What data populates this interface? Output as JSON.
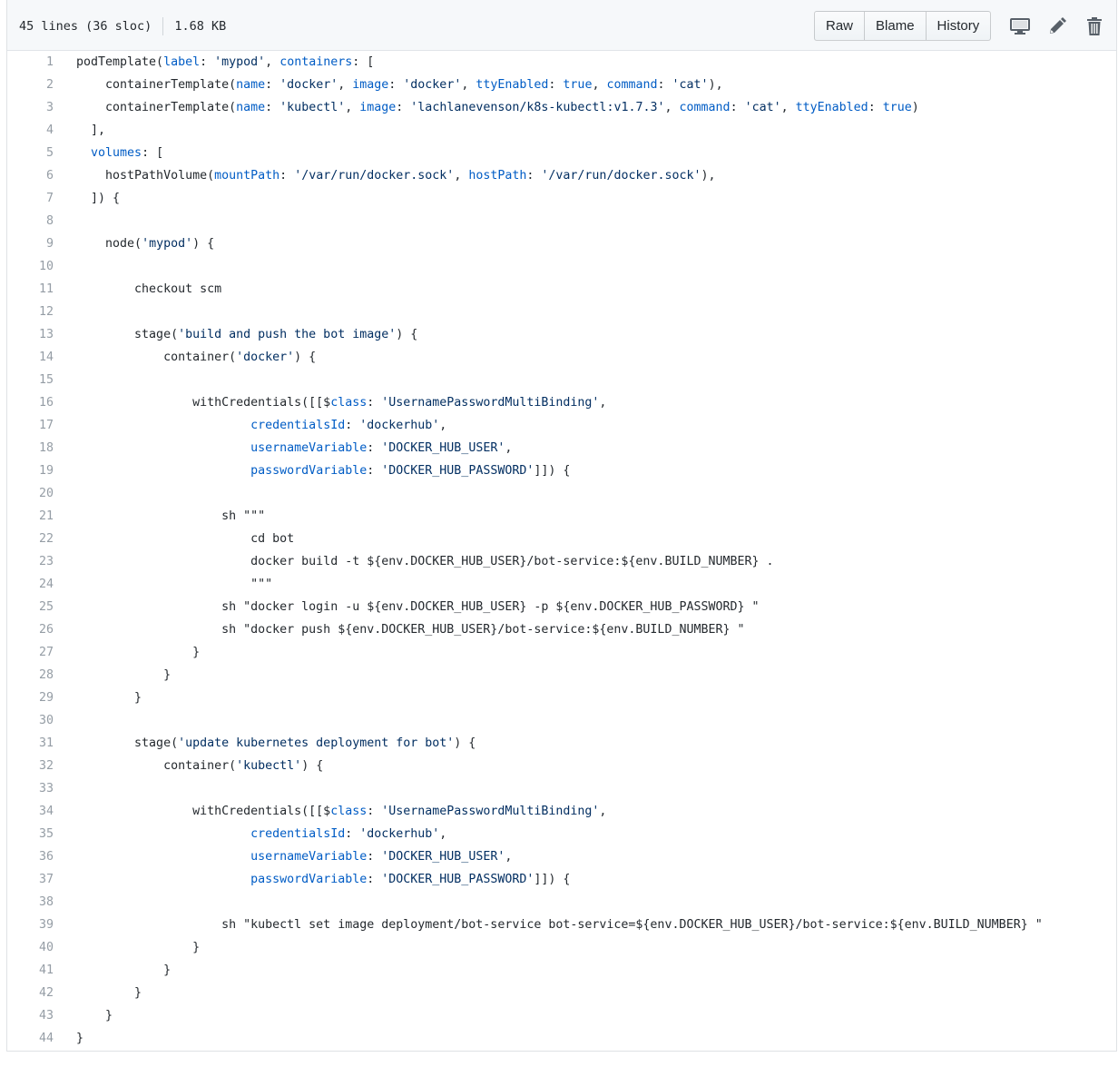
{
  "file": {
    "lines_info": "45 lines (36 sloc)",
    "size": "1.68 KB"
  },
  "toolbar": {
    "raw_label": "Raw",
    "blame_label": "Blame",
    "history_label": "History",
    "icons": {
      "desktop": "desktop-icon",
      "edit": "pencil-icon",
      "delete": "trash-icon"
    }
  },
  "colors": {
    "keyword": "#005cc5",
    "string": "#032f62",
    "line_number": "#959da5",
    "text": "#24292e"
  },
  "code_lines": [
    "podTemplate(label: 'mypod', containers: [",
    "    containerTemplate(name: 'docker', image: 'docker', ttyEnabled: true, command: 'cat'),",
    "    containerTemplate(name: 'kubectl', image: 'lachlanevenson/k8s-kubectl:v1.7.3', command: 'cat', ttyEnabled: true)",
    "  ],",
    "  volumes: [",
    "    hostPathVolume(mountPath: '/var/run/docker.sock', hostPath: '/var/run/docker.sock'),",
    "  ]) {",
    "",
    "    node('mypod') {",
    "",
    "        checkout scm",
    "",
    "        stage('build and push the bot image') {",
    "            container('docker') {",
    "",
    "                withCredentials([[$class: 'UsernamePasswordMultiBinding',",
    "                        credentialsId: 'dockerhub',",
    "                        usernameVariable: 'DOCKER_HUB_USER',",
    "                        passwordVariable: 'DOCKER_HUB_PASSWORD']]) {",
    "",
    "                    sh \"\"\"",
    "                        cd bot",
    "                        docker build -t ${env.DOCKER_HUB_USER}/bot-service:${env.BUILD_NUMBER} .",
    "                        \"\"\"",
    "                    sh \"docker login -u ${env.DOCKER_HUB_USER} -p ${env.DOCKER_HUB_PASSWORD} \"",
    "                    sh \"docker push ${env.DOCKER_HUB_USER}/bot-service:${env.BUILD_NUMBER} \"",
    "                }",
    "            }",
    "        }",
    "",
    "        stage('update kubernetes deployment for bot') {",
    "            container('kubectl') {",
    "",
    "                withCredentials([[$class: 'UsernamePasswordMultiBinding',",
    "                        credentialsId: 'dockerhub',",
    "                        usernameVariable: 'DOCKER_HUB_USER',",
    "                        passwordVariable: 'DOCKER_HUB_PASSWORD']]) {",
    "",
    "                    sh \"kubectl set image deployment/bot-service bot-service=${env.DOCKER_HUB_USER}/bot-service:${env.BUILD_NUMBER} \"",
    "                }",
    "            }",
    "        }",
    "    }",
    "}"
  ]
}
